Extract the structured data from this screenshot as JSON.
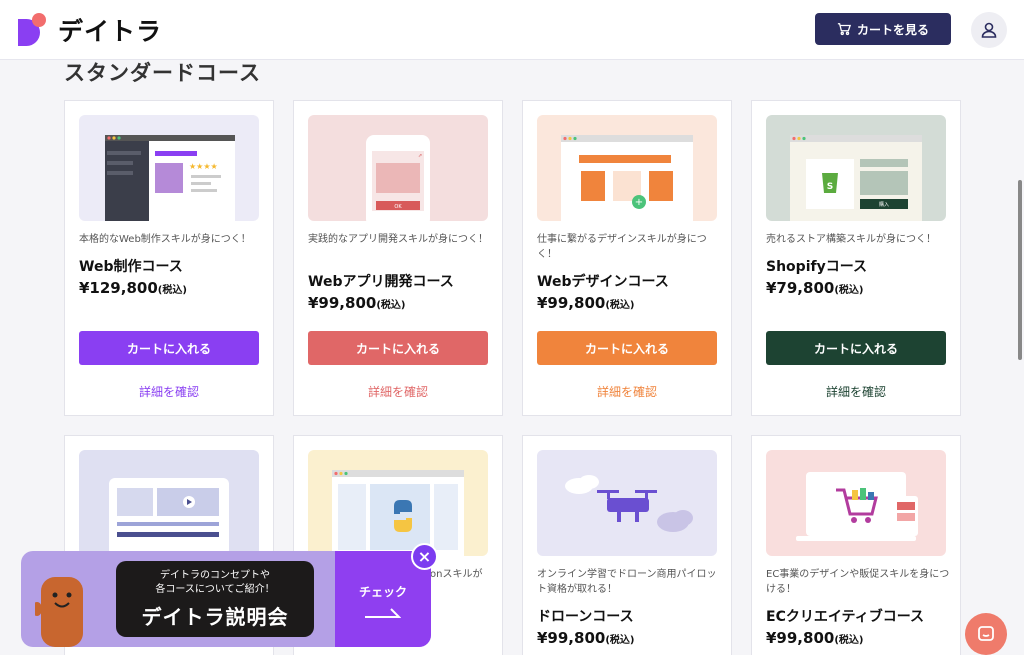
{
  "header": {
    "logo_text": "デイトラ",
    "cart_label": "カートを見る"
  },
  "section": {
    "title": "スタンダードコース"
  },
  "courses": [
    {
      "tagline": "本格的なWeb制作スキルが身につく！",
      "name": "Web制作コース",
      "price": "¥129,800",
      "tax": "(税込)",
      "button": "カートに入れる",
      "detail": "詳細を確認",
      "color": "#8a3ff2"
    },
    {
      "tagline": "実践的なアプリ開発スキルが身につく！",
      "name": "Webアプリ開発コース",
      "price": "¥99,800",
      "tax": "(税込)",
      "button": "カートに入れる",
      "detail": "詳細を確認",
      "color": "#e06767",
      "thumb_button": "OK"
    },
    {
      "tagline": "仕事に繋がるデザインスキルが身につく！",
      "name": "Webデザインコース",
      "price": "¥99,800",
      "tax": "(税込)",
      "button": "カートに入れる",
      "detail": "詳細を確認",
      "color": "#f0843c"
    },
    {
      "tagline": "売れるストア構築スキルが身につく！",
      "name": "Shopifyコース",
      "price": "¥79,800",
      "tax": "(税込)",
      "button": "カートに入れる",
      "detail": "詳細を確認",
      "color": "#1d4332",
      "thumb_button": "購入"
    },
    {
      "tagline": "",
      "name": "",
      "price": "",
      "tax": ""
    },
    {
      "tagline": "onスキルが",
      "name": "",
      "price": "",
      "tax": ""
    },
    {
      "tagline": "オンライン学習でドローン商用パイロット資格が取れる！",
      "name": "ドローンコース",
      "price": "¥99,800",
      "tax": "(税込)"
    },
    {
      "tagline": "EC事業のデザインや販促スキルを身につける！",
      "name": "ECクリエイティブコース",
      "price": "¥99,800",
      "tax": "(税込)"
    }
  ],
  "promo": {
    "sub_line1": "デイトラのコンセプトや",
    "sub_line2": "各コースについてご紹介！",
    "title": "デイトラ説明会",
    "check": "チェック",
    "close": "×"
  },
  "icons": {
    "cart": "cart-icon",
    "user": "user-icon",
    "chat": "chat-icon",
    "arrow": "arrow-right-icon"
  }
}
